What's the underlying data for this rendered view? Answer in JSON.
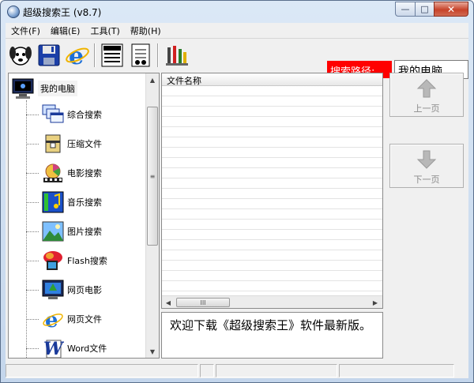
{
  "window": {
    "title": "超级搜索王 (v8.7)",
    "minimize": "—",
    "maximize": "□",
    "close": "✕"
  },
  "menu": [
    {
      "label": "文件(F)"
    },
    {
      "label": "编辑(E)"
    },
    {
      "label": "工具(T)"
    },
    {
      "label": "帮助(H)"
    }
  ],
  "toolbar": {
    "buttons": [
      "dog-icon",
      "save-icon",
      "internet-explorer-icon",
      "top-list-icon",
      "document-icon",
      "binoculars-icon",
      "tools-icon"
    ]
  },
  "search_path": {
    "label": "搜索路径:",
    "value": "我的电脑"
  },
  "tree": {
    "root": "我的电脑",
    "items": [
      {
        "label": "综合搜索",
        "icon": "multi-window-icon"
      },
      {
        "label": "压缩文件",
        "icon": "archive-icon"
      },
      {
        "label": "电影搜索",
        "icon": "film-icon"
      },
      {
        "label": "音乐搜索",
        "icon": "music-icon"
      },
      {
        "label": "图片搜索",
        "icon": "picture-icon"
      },
      {
        "label": "Flash搜索",
        "icon": "flash-icon"
      },
      {
        "label": "网页电影",
        "icon": "web-movie-icon"
      },
      {
        "label": "网页文件",
        "icon": "ie-page-icon"
      },
      {
        "label": "Word文件",
        "icon": "word-icon"
      }
    ]
  },
  "file_list": {
    "column_header": "文件名称",
    "rows": []
  },
  "message": "欢迎下载《超级搜索王》软件最新版。",
  "nav": {
    "prev_label": "上一页",
    "next_label": "下一页"
  },
  "scroll": {
    "grip": "≡",
    "hgrip": "III"
  },
  "colors": {
    "path_label_bg": "#ff0000",
    "title_bg": "#dbe8f6",
    "close_button": "#c7432a"
  }
}
